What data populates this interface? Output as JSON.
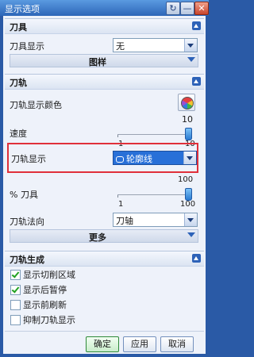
{
  "window": {
    "title": "显示选项",
    "buttons": {
      "reset": "↻",
      "minimize": "—",
      "close": "✕"
    }
  },
  "tool_section": {
    "header": "刀具",
    "tool_display_label": "刀具显示",
    "tool_display_value": "无",
    "graphics_bar": "图样"
  },
  "path_section": {
    "header": "刀轨",
    "path_color_label": "刀轨显示颜色",
    "speed_value": "10",
    "speed_label": "速度",
    "speed_min": "1",
    "speed_max": "10",
    "speed_level": 1.0,
    "path_display_label": "刀轨显示",
    "path_display_value": "轮廓线",
    "tool_percent_value": "100",
    "tool_percent_label": "% 刀具",
    "tool_percent_min": "1",
    "tool_percent_max": "100",
    "tool_percent_level": 1.0,
    "path_axis_label": "刀轨法向",
    "path_axis_value": "刀轴",
    "more_bar": "更多"
  },
  "generation_section": {
    "header": "刀轨生成",
    "options": [
      {
        "label": "显示切削区域",
        "checked": true
      },
      {
        "label": "显示后暂停",
        "checked": true
      },
      {
        "label": "显示前刷新",
        "checked": false
      },
      {
        "label": "抑制刀轨显示",
        "checked": false
      }
    ]
  },
  "footer": {
    "ok": "确定",
    "apply": "应用",
    "cancel": "取消"
  },
  "colors": {
    "title_bar": "#2d66b8",
    "highlight_box": "#e0303a",
    "selected_dropdown": "#2870d8"
  }
}
